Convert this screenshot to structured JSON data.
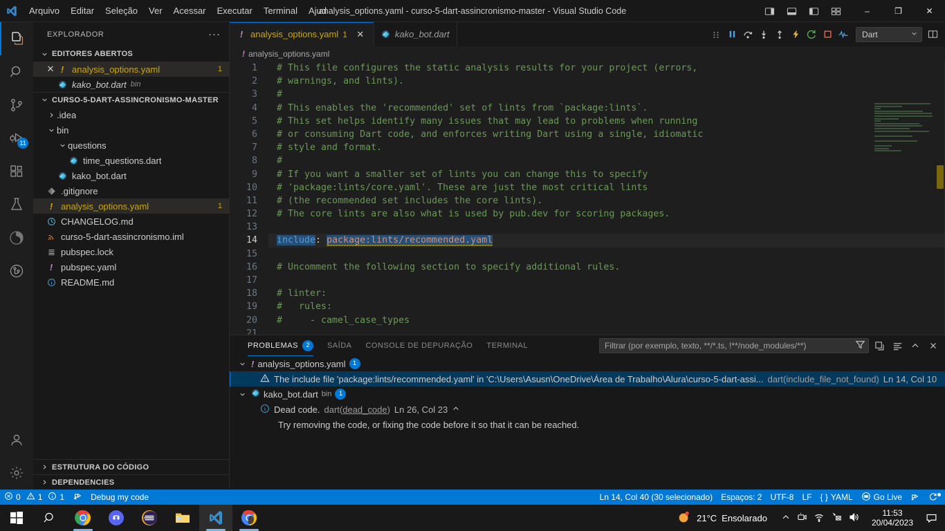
{
  "titlebar": {
    "menus": [
      "Arquivo",
      "Editar",
      "Seleção",
      "Ver",
      "Acessar",
      "Executar",
      "Terminal",
      "Ajud"
    ],
    "window_title": "analysis_options.yaml - curso-5-dart-assincronismo-master - Visual Studio Code",
    "minimize": "–",
    "maximize": "❐",
    "close": "✕"
  },
  "activitybar": {
    "items": [
      {
        "name": "explorer",
        "icon": "files-icon",
        "badge": ""
      },
      {
        "name": "search",
        "icon": "search-icon",
        "badge": ""
      },
      {
        "name": "source-control",
        "icon": "source-control-icon",
        "badge": ""
      },
      {
        "name": "run-and-debug",
        "icon": "debug-icon",
        "badge": "11"
      },
      {
        "name": "extensions",
        "icon": "extensions-icon",
        "badge": ""
      },
      {
        "name": "testing",
        "icon": "beaker-icon",
        "badge": ""
      },
      {
        "name": "docker",
        "icon": "docker-icon",
        "badge": ""
      },
      {
        "name": "git-graph",
        "icon": "git-graph-icon",
        "badge": ""
      }
    ],
    "bottom": [
      {
        "name": "accounts",
        "icon": "account-icon"
      },
      {
        "name": "settings",
        "icon": "gear-icon"
      }
    ]
  },
  "sidebar": {
    "title": "EXPLORADOR",
    "more_actions": "···",
    "open_editors": {
      "label": "EDITORES ABERTOS",
      "items": [
        {
          "name": "analysis_options.yaml",
          "sub": "",
          "count": "1",
          "selected": true,
          "icon": "yaml-warning-icon",
          "close": "✕"
        },
        {
          "name": "kako_bot.dart",
          "sub": "bin",
          "count": "",
          "selected": false,
          "icon": "dart-icon",
          "close": ""
        }
      ]
    },
    "project": {
      "label": "CURSO-5-DART-ASSINCRONISMO-MASTER",
      "items": [
        {
          "name": ".idea",
          "type": "folder",
          "expanded": false,
          "depth": 1,
          "count": "",
          "selected": false,
          "icon": "folder-icon"
        },
        {
          "name": "bin",
          "type": "folder",
          "expanded": true,
          "depth": 1,
          "count": "",
          "selected": false,
          "icon": "folder-icon"
        },
        {
          "name": "questions",
          "type": "folder",
          "expanded": true,
          "depth": 2,
          "count": "",
          "selected": false,
          "icon": "folder-icon"
        },
        {
          "name": "time_questions.dart",
          "type": "file",
          "depth": 3,
          "count": "",
          "selected": false,
          "icon": "dart-icon"
        },
        {
          "name": "kako_bot.dart",
          "type": "file",
          "depth": 2,
          "count": "",
          "selected": false,
          "icon": "dart-icon"
        },
        {
          "name": ".gitignore",
          "type": "file",
          "depth": 1,
          "count": "",
          "selected": false,
          "icon": "git-icon"
        },
        {
          "name": "analysis_options.yaml",
          "type": "file",
          "depth": 1,
          "count": "1",
          "selected": true,
          "icon": "yaml-warning-icon"
        },
        {
          "name": "CHANGELOG.md",
          "type": "file",
          "depth": 1,
          "count": "",
          "selected": false,
          "icon": "clock-icon"
        },
        {
          "name": "curso-5-dart-assincronismo.iml",
          "type": "file",
          "depth": 1,
          "count": "",
          "selected": false,
          "icon": "xml-icon"
        },
        {
          "name": "pubspec.lock",
          "type": "file",
          "depth": 1,
          "count": "",
          "selected": false,
          "icon": "lines-icon"
        },
        {
          "name": "pubspec.yaml",
          "type": "file",
          "depth": 1,
          "count": "",
          "selected": false,
          "icon": "yaml-icon"
        },
        {
          "name": "README.md",
          "type": "file",
          "depth": 1,
          "count": "",
          "selected": false,
          "icon": "info-icon"
        }
      ]
    },
    "collapsed_sections": [
      "ESTRUTURA DO CÓDIGO",
      "DEPENDENCIES"
    ]
  },
  "editor": {
    "tabs": [
      {
        "label": "analysis_options.yaml",
        "count": "1",
        "active": true,
        "icon": "yaml-warning-icon",
        "close": "✕"
      },
      {
        "label": "kako_bot.dart",
        "count": "",
        "active": false,
        "icon": "dart-icon",
        "close": ""
      }
    ],
    "debug_toolbar": {
      "buttons": [
        "drag-handle-icon",
        "pause-icon",
        "step-over-icon",
        "step-into-icon",
        "step-out-icon",
        "restart-icon",
        "reverse-continue-icon",
        "stop-icon",
        "debug-console-icon"
      ],
      "session_value": "Dart",
      "chevron": "⌄"
    },
    "split_editor": "split-editor-icon",
    "breadcrumb": {
      "icon": "yaml-warning-icon",
      "label": "analysis_options.yaml"
    },
    "lines": [
      {
        "n": "1",
        "segments": [
          {
            "t": "# This file configures the static analysis results for your project (errors,",
            "c": "cm"
          }
        ]
      },
      {
        "n": "2",
        "segments": [
          {
            "t": "# warnings, and lints).",
            "c": "cm"
          }
        ]
      },
      {
        "n": "3",
        "segments": [
          {
            "t": "#",
            "c": "cm"
          }
        ]
      },
      {
        "n": "4",
        "segments": [
          {
            "t": "# This enables the 'recommended' set of lints from `package:lints`.",
            "c": "cm"
          }
        ]
      },
      {
        "n": "5",
        "segments": [
          {
            "t": "# This set helps identify many issues that may lead to problems when running",
            "c": "cm"
          }
        ]
      },
      {
        "n": "6",
        "segments": [
          {
            "t": "# or consuming Dart code, and enforces writing Dart using a single, idiomatic",
            "c": "cm"
          }
        ]
      },
      {
        "n": "7",
        "segments": [
          {
            "t": "# style and format.",
            "c": "cm"
          }
        ]
      },
      {
        "n": "8",
        "segments": [
          {
            "t": "#",
            "c": "cm"
          }
        ]
      },
      {
        "n": "9",
        "segments": [
          {
            "t": "# If you want a smaller set of lints you can change this to specify",
            "c": "cm"
          }
        ]
      },
      {
        "n": "10",
        "segments": [
          {
            "t": "# 'package:lints/core.yaml'. These are just the most critical lints",
            "c": "cm"
          }
        ]
      },
      {
        "n": "11",
        "segments": [
          {
            "t": "# (the recommended set includes the core lints).",
            "c": "cm"
          }
        ]
      },
      {
        "n": "12",
        "segments": [
          {
            "t": "# The core lints are also what is used by pub.dev for scoring packages.",
            "c": "cm"
          }
        ]
      },
      {
        "n": "13",
        "segments": []
      },
      {
        "n": "14",
        "current": true,
        "segments": [
          {
            "t": "include",
            "c": "ckey sel"
          },
          {
            "t": ":",
            "c": ""
          },
          {
            "t": " ",
            "c": ""
          },
          {
            "t": "package:lints/recommended.yaml",
            "c": "cval sel squiggle"
          }
        ]
      },
      {
        "n": "15",
        "segments": []
      },
      {
        "n": "16",
        "segments": [
          {
            "t": "# Uncomment the following section to specify additional rules.",
            "c": "cm"
          }
        ]
      },
      {
        "n": "17",
        "segments": []
      },
      {
        "n": "18",
        "segments": [
          {
            "t": "# linter:",
            "c": "cm"
          }
        ]
      },
      {
        "n": "19",
        "segments": [
          {
            "t": "#   rules:",
            "c": "cm"
          }
        ]
      },
      {
        "n": "20",
        "segments": [
          {
            "t": "#     - camel_case_types",
            "c": "cm"
          }
        ]
      },
      {
        "n": "21",
        "segments": []
      }
    ]
  },
  "panel": {
    "tabs": [
      {
        "label": "PROBLEMAS",
        "badge": "2",
        "active": true
      },
      {
        "label": "SAÍDA",
        "badge": "",
        "active": false
      },
      {
        "label": "CONSOLE DE DEPURAÇÃO",
        "badge": "",
        "active": false
      },
      {
        "label": "TERMINAL",
        "badge": "",
        "active": false
      }
    ],
    "filter_placeholder": "Filtrar (por exemplo, texto, **/*.ts, !**/node_modules/**)",
    "filter_value": "",
    "actions": [
      "filter-icon",
      "collapse-all-icon",
      "view-as-list-icon",
      "maximize-panel-icon",
      "close-panel-icon"
    ],
    "groups": [
      {
        "file": "analysis_options.yaml",
        "sub": "",
        "badge": "1",
        "icon": "yaml-warning-icon",
        "items": [
          {
            "severity": "warning-icon",
            "message": "The include file 'package:lints/recommended.yaml' in 'C:\\Users\\Asusn\\OneDrive\\Área de Trabalho\\Alura\\curso-5-dart-assi...",
            "code": "dart(include_file_not_found)",
            "position": "Ln 14, Col 10",
            "selected": true,
            "extra": ""
          }
        ]
      },
      {
        "file": "kako_bot.dart",
        "sub": "bin",
        "badge": "1",
        "icon": "dart-icon",
        "items": [
          {
            "severity": "info-icon",
            "message": "Dead code.",
            "code": "dart(dead_code)",
            "code_link": "dead_code",
            "position": "Ln 26, Col 23",
            "selected": false,
            "chevron": "⌃",
            "extra": "Try removing the code, or fixing the code before it so that it can be reached."
          }
        ]
      }
    ]
  },
  "statusbar": {
    "errors": "0",
    "warnings": "1",
    "infos": "1",
    "debug_label": "Debug my code",
    "cursor": "Ln 14, Col 40 (30 selecionado)",
    "indent": "Espaços: 2",
    "encoding": "UTF-8",
    "eol": "LF",
    "language": "YAML",
    "golive": "Go Live",
    "accent": "#0078d4"
  },
  "taskbar": {
    "items": [
      {
        "name": "start-button",
        "icon": "windows-icon"
      },
      {
        "name": "search-taskbar",
        "icon": "search-icon"
      },
      {
        "name": "chrome",
        "icon": "chrome-icon"
      },
      {
        "name": "discord",
        "icon": "discord-icon"
      },
      {
        "name": "eclipse",
        "icon": "eclipse-icon"
      },
      {
        "name": "file-explorer",
        "icon": "folder-icon"
      },
      {
        "name": "vscode",
        "icon": "vscode-icon"
      },
      {
        "name": "chrome-window",
        "icon": "chrome-icon"
      }
    ],
    "weather_temp": "21°C",
    "weather_desc": "Ensolarado",
    "time": "11:53",
    "date": "20/04/2023",
    "tray": [
      "chevron-up-icon",
      "camera-icon",
      "wifi-icon",
      "network-off-icon",
      "volume-icon"
    ],
    "notification": "notification-icon"
  }
}
